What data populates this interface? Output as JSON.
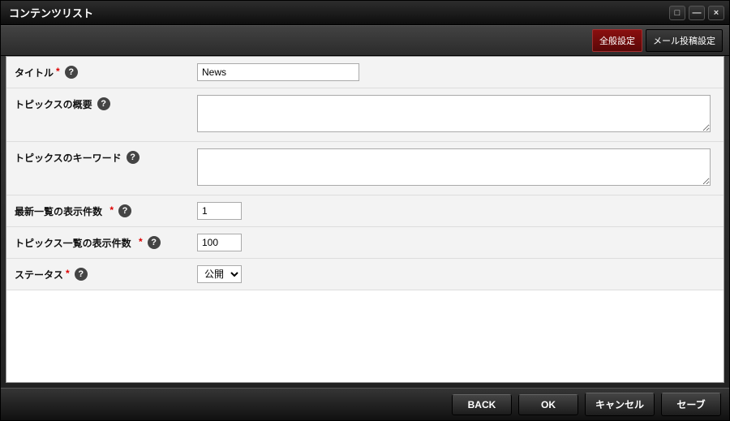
{
  "window": {
    "title": "コンテンツリスト"
  },
  "tabs": {
    "general": "全般設定",
    "mail": "メール投稿設定"
  },
  "form": {
    "title": {
      "label": "タイトル",
      "required": true,
      "value": "News"
    },
    "summary": {
      "label": "トピックスの概要",
      "required": false,
      "value": ""
    },
    "keywords": {
      "label": "トピックスのキーワード",
      "required": false,
      "value": ""
    },
    "latestCount": {
      "label": "最新一覧の表示件数",
      "required": true,
      "value": "1"
    },
    "topicsCount": {
      "label": "トピックス一覧の表示件数",
      "required": true,
      "value": "100"
    },
    "status": {
      "label": "ステータス",
      "required": true,
      "selected": "公開",
      "options": [
        "公開"
      ]
    }
  },
  "footer": {
    "back": "BACK",
    "ok": "OK",
    "cancel": "キャンセル",
    "save": "セーブ"
  },
  "glyph": {
    "maximize": "□",
    "minimize": "—",
    "close": "×",
    "help": "?"
  }
}
